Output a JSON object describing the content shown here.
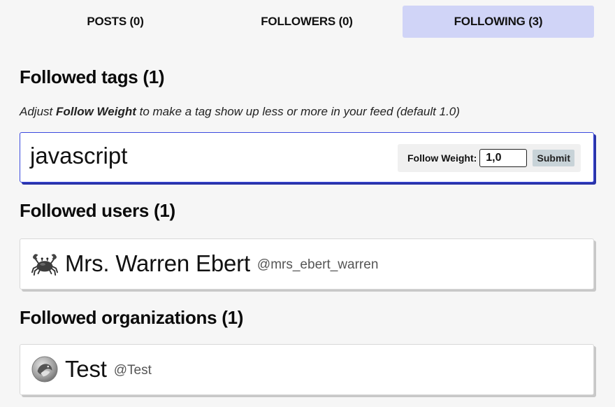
{
  "tabs": [
    {
      "label": "POSTS (0)",
      "active": false
    },
    {
      "label": "FOLLOWERS (0)",
      "active": false
    },
    {
      "label": "FOLLOWING (3)",
      "active": true
    }
  ],
  "tags_section": {
    "heading": "Followed tags (1)",
    "hint_prefix": "Adjust ",
    "hint_bold": "Follow Weight",
    "hint_suffix": " to make a tag show up less or more in your feed (default 1.0)",
    "items": [
      {
        "name": "javascript",
        "weight_label": "Follow Weight:",
        "weight_value": "1,0",
        "submit_label": "Submit"
      }
    ]
  },
  "users_section": {
    "heading": "Followed users (1)",
    "items": [
      {
        "name": "Mrs. Warren Ebert",
        "handle": "@mrs_ebert_warren",
        "avatar_icon": "crab-icon"
      }
    ]
  },
  "orgs_section": {
    "heading": "Followed organizations (1)",
    "items": [
      {
        "name": "Test",
        "handle": "@Test",
        "avatar_icon": "org-logo-icon"
      }
    ]
  },
  "colors": {
    "active_tab": "#d0d4f7",
    "tag_border": "#3b49df",
    "page_bg": "#f6f6f6"
  }
}
